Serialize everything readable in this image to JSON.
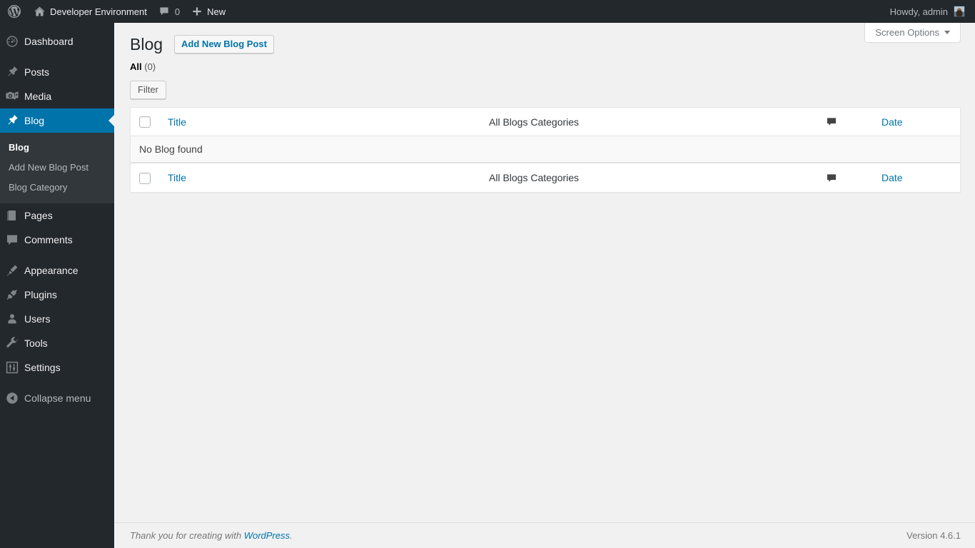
{
  "adminbar": {
    "logo_icon": "wordpress-logo-icon",
    "site_home_icon": "home-icon",
    "site_name": "Developer Environment",
    "comments_icon": "comment-bubble-icon",
    "comments_count": "0",
    "new_icon": "plus-icon",
    "new_label": "New",
    "howdy": "Howdy, admin",
    "avatar_icon": "avatar"
  },
  "sidebar": {
    "items": [
      {
        "label": "Dashboard",
        "icon": "dashboard-gauge-icon",
        "current": false
      },
      {
        "label": "Posts",
        "icon": "pin-icon",
        "current": false
      },
      {
        "label": "Media",
        "icon": "media-camera-icon",
        "current": false
      },
      {
        "label": "Blog",
        "icon": "pin-icon",
        "current": true
      },
      {
        "label": "Pages",
        "icon": "page-icon",
        "current": false
      },
      {
        "label": "Comments",
        "icon": "comment-bubble-icon",
        "current": false
      },
      {
        "label": "Appearance",
        "icon": "paintbrush-icon",
        "current": false
      },
      {
        "label": "Plugins",
        "icon": "plug-icon",
        "current": false
      },
      {
        "label": "Users",
        "icon": "user-icon",
        "current": false
      },
      {
        "label": "Tools",
        "icon": "wrench-icon",
        "current": false
      },
      {
        "label": "Settings",
        "icon": "settings-sliders-icon",
        "current": false
      }
    ],
    "submenu": [
      {
        "label": "Blog",
        "current": true
      },
      {
        "label": "Add New Blog Post",
        "current": false
      },
      {
        "label": "Blog Category",
        "current": false
      }
    ],
    "collapse": {
      "label": "Collapse menu",
      "icon": "collapse-arrow-icon"
    },
    "active_color": "#0073aa",
    "background": "#23282d",
    "submenu_background": "#32373c"
  },
  "screen_meta": {
    "screen_options_label": "Screen Options",
    "caret_icon": "chevron-down-icon"
  },
  "page": {
    "title": "Blog",
    "add_new_label": "Add New Blog Post",
    "status_label": "All",
    "status_count": "(0)",
    "filter_label": "Filter"
  },
  "table": {
    "columns": {
      "checkbox": "select-all",
      "title": "Title",
      "categories": "All Blogs Categories",
      "comments_icon": "comment-bubble-icon",
      "date": "Date"
    },
    "empty_message": "No Blog found"
  },
  "footer": {
    "thanks_prefix": "Thank you for creating with ",
    "wordpress_link": "WordPress",
    "thanks_suffix": ".",
    "version": "Version 4.6.1"
  }
}
